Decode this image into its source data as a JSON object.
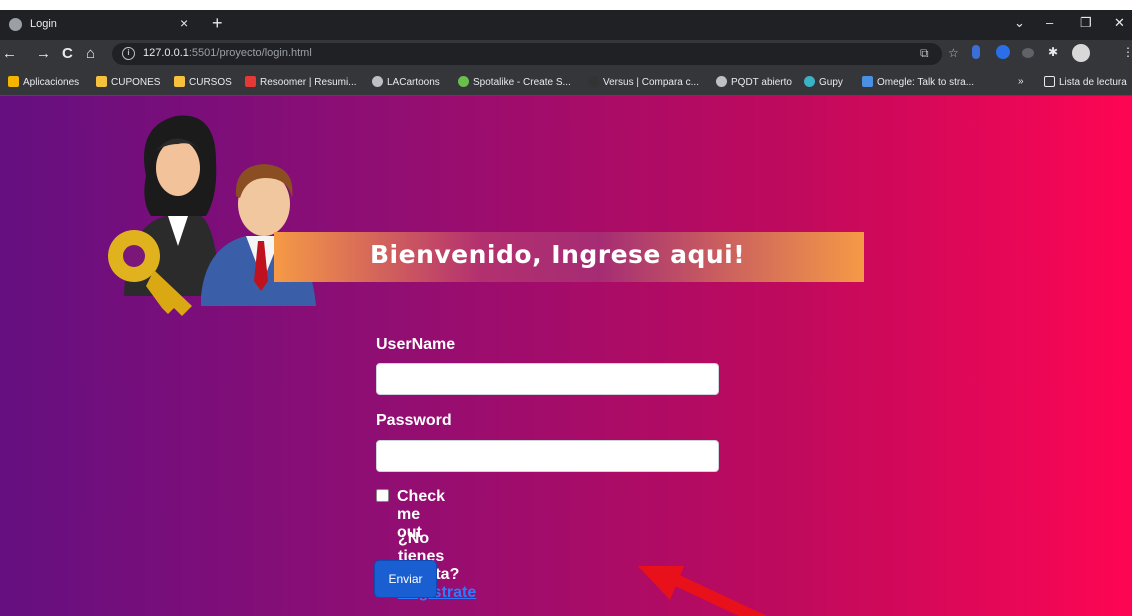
{
  "browser": {
    "tab_title": "Login",
    "tab_close": "×",
    "new_tab": "+",
    "url_host": "127.0.0.1",
    "url_path": ":5501/proyecto/login.html",
    "nav": {
      "back": "←",
      "forward": "→",
      "reload": "C",
      "home": "⌂"
    },
    "window_controls": {
      "minimize": "–",
      "restore": "❐",
      "close": "✕",
      "tabsearch": "⌄"
    }
  },
  "bookmarks": {
    "items": [
      {
        "label": "Aplicaciones",
        "icon": "apps-grid-icon",
        "color": "#f4b400"
      },
      {
        "label": "CUPONES",
        "icon": "folder-icon",
        "color": "#f6c23e"
      },
      {
        "label": "CURSOS",
        "icon": "folder-icon",
        "color": "#f6c23e"
      },
      {
        "label": "Resoomer | Resumi...",
        "icon": "resoomer-icon",
        "color": "#e53935"
      },
      {
        "label": "LACartoons",
        "icon": "globe-icon",
        "color": "#bdc1c6"
      },
      {
        "label": "Spotalike - Create S...",
        "icon": "spotalike-icon",
        "color": "#6abf4b"
      },
      {
        "label": "Versus | Compara c...",
        "icon": "versus-icon",
        "color": "#333333"
      },
      {
        "label": "PQDT abierto",
        "icon": "globe-icon",
        "color": "#bdc1c6"
      },
      {
        "label": "Gupy",
        "icon": "gupy-icon",
        "color": "#39b3c6"
      },
      {
        "label": "Omegle: Talk to stra...",
        "icon": "omegle-icon",
        "color": "#4a90e2"
      }
    ],
    "more": "»",
    "reading_list": "Lista de lectura"
  },
  "page": {
    "banner_title": "Bienvenido, Ingrese aqui!",
    "username_label": "UserName",
    "username_value": "",
    "password_label": "Password",
    "password_value": "",
    "remember_label": "Check me out",
    "no_account_text": "¿No tienes cuenta?",
    "register_link": "Registrate",
    "submit_label": "Enviar"
  },
  "colors": {
    "gradient_left": "#650f80",
    "gradient_right": "#fe0553",
    "button": "#1a5fd1",
    "link": "#2b7cff",
    "arrow": "#e8101a"
  }
}
